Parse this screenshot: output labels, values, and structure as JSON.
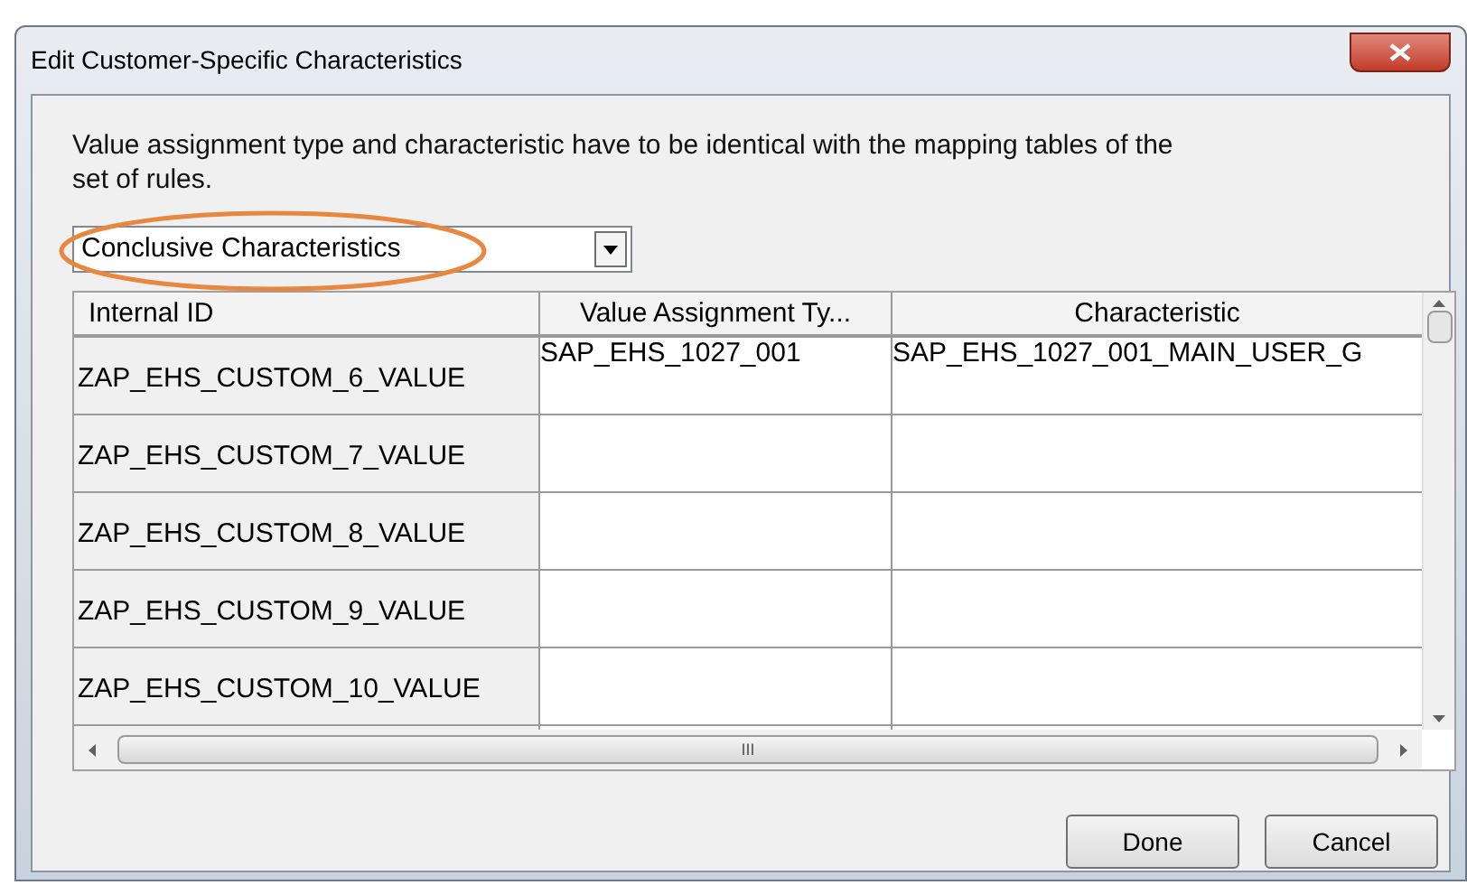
{
  "window": {
    "title": "Edit Customer-Specific Characteristics"
  },
  "message": "Value assignment type and characteristic have to be identical with the mapping tables of the set of rules.",
  "dropdown": {
    "value": "Conclusive Characteristics",
    "highlighted": true
  },
  "table": {
    "columns": [
      "Internal ID",
      "Value Assignment Ty...",
      "Characteristic"
    ],
    "rows": [
      {
        "internal_id": "ZAP_EHS_CUSTOM_6_VALUE",
        "value_assignment_type": "SAP_EHS_1027_001",
        "characteristic": "SAP_EHS_1027_001_MAIN_USER_G"
      },
      {
        "internal_id": "ZAP_EHS_CUSTOM_7_VALUE"
      },
      {
        "internal_id": "ZAP_EHS_CUSTOM_8_VALUE"
      },
      {
        "internal_id": "ZAP_EHS_CUSTOM_9_VALUE"
      },
      {
        "internal_id": "ZAP_EHS_CUSTOM_10_VALUE"
      }
    ],
    "scroll_mark": "III"
  },
  "buttons": [
    "Done",
    "Cancel"
  ]
}
